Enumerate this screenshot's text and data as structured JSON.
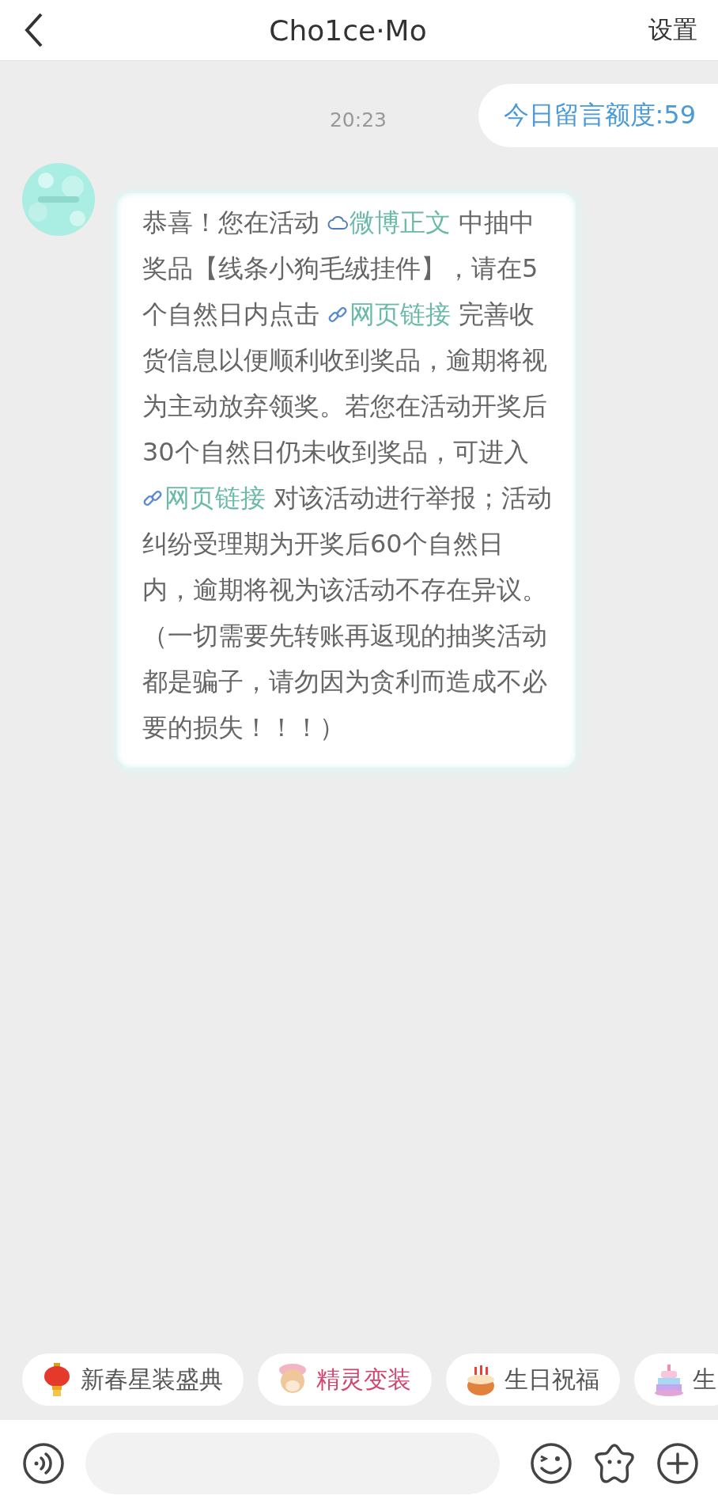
{
  "header": {
    "title": "Cho1ce·Mo",
    "action": "设置"
  },
  "messages": [
    {
      "kind": "time",
      "text": "20:23"
    },
    {
      "kind": "outgoing",
      "text": "今日留言额度:59"
    },
    {
      "kind": "incoming",
      "segments": [
        {
          "kind": "text",
          "text": "恭喜！您在活动 "
        },
        {
          "kind": "post-link",
          "text": "微博正文"
        },
        {
          "kind": "text",
          "text": "  中抽中奖品【线条小狗毛绒挂件】，请在5个自然日内点击 "
        },
        {
          "kind": "web-link",
          "text": "网页链接"
        },
        {
          "kind": "text",
          "text": "  完善收货信息以便顺利收到奖品，逾期将视为主动放弃领奖。若您在活动开奖后30个自然日仍未收到奖品，可进入 "
        },
        {
          "kind": "web-link",
          "text": "网页链接"
        },
        {
          "kind": "text",
          "text": "  对该活动进行举报；活动纠纷受理期为开奖后60个自然日内，逾期将视为该活动不存在异议。（一切需要先转账再返现的抽奖活动都是骗子，请勿因为贪利而造成不必要的损失！！！）"
        }
      ]
    }
  ],
  "chips": [
    {
      "kind": "lantern",
      "label": "新春星装盛典",
      "color": "#555555"
    },
    {
      "kind": "fawn",
      "label": "精灵变装",
      "color": "#d2456e"
    },
    {
      "kind": "cake",
      "label": "生日祝福",
      "color": "#555555"
    },
    {
      "kind": "rainbow-cake",
      "label": "生",
      "color": "#555555"
    }
  ]
}
